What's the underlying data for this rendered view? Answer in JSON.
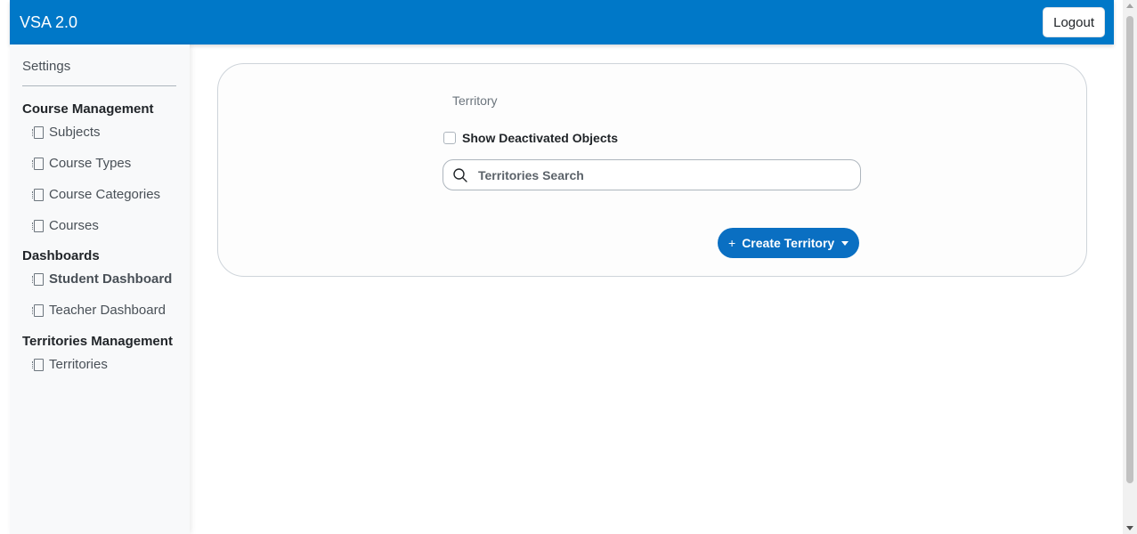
{
  "app": {
    "brand": "VSA 2.0",
    "logout_label": "Logout"
  },
  "sidebar": {
    "title": "Settings",
    "sections": [
      {
        "heading": "Course Management",
        "items": [
          "Subjects",
          "Course Types",
          "Course Categories",
          "Courses"
        ]
      },
      {
        "heading": "Dashboards",
        "items": [
          "Student Dashboard",
          "Teacher Dashboard"
        ],
        "active": "Student Dashboard"
      },
      {
        "heading": "Territories Management",
        "items": [
          "Territories"
        ]
      }
    ]
  },
  "main": {
    "title": "Territory",
    "show_deactivated_label": "Show Deactivated Objects",
    "show_deactivated_checked": false,
    "search_placeholder": "Territories Search",
    "create_button_label": "Create Territory",
    "create_button_icon": "plus-icon"
  },
  "colors": {
    "navbar": "#0078c8",
    "primary_button": "#0a6fc2",
    "sidebar_bg": "#f8f9fa"
  }
}
